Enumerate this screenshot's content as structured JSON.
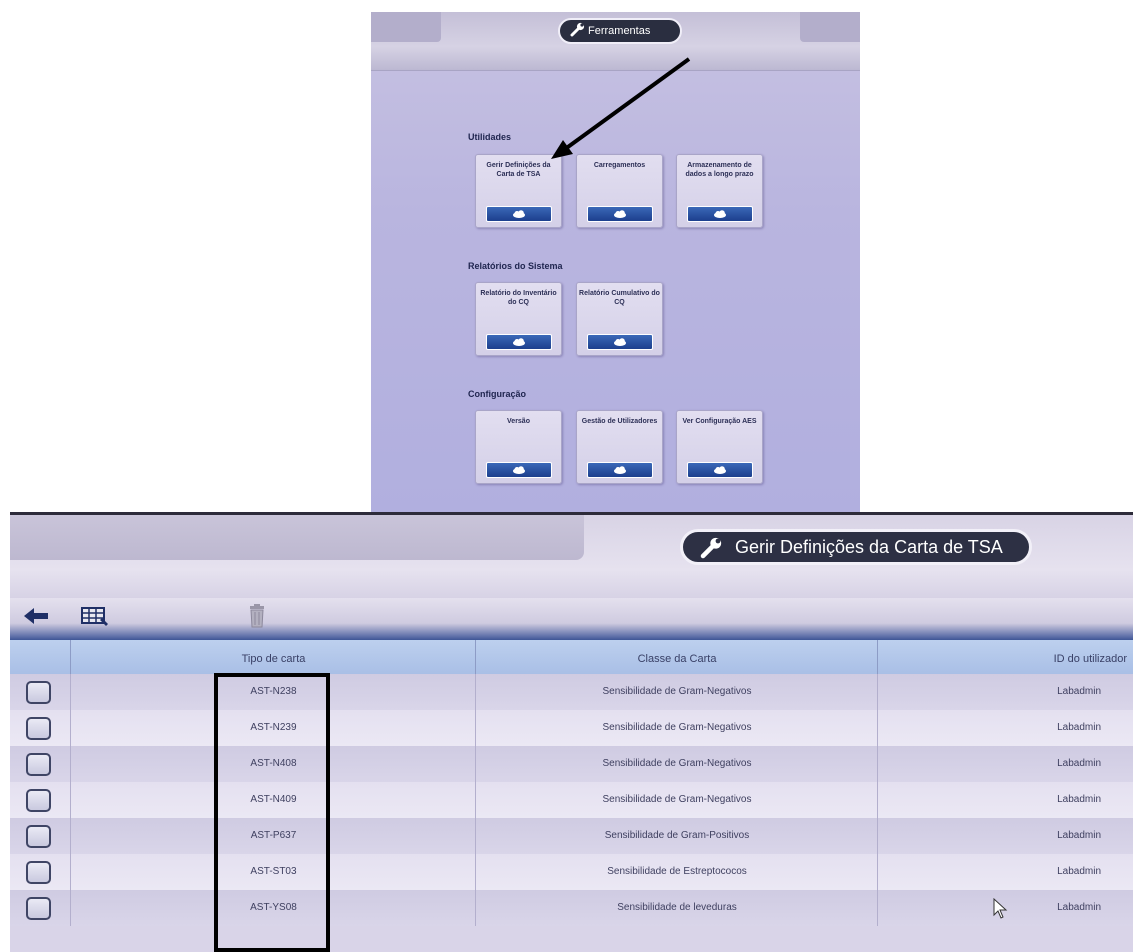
{
  "top_screen": {
    "title": "Ferramentas",
    "sections": [
      {
        "label": "Utilidades",
        "tiles": [
          {
            "label": "Gerir Definições da Carta de TSA"
          },
          {
            "label": "Carregamentos"
          },
          {
            "label": "Armazenamento de dados a longo prazo"
          }
        ]
      },
      {
        "label": "Relatórios do Sistema",
        "tiles": [
          {
            "label": "Relatório do Inventário do CQ"
          },
          {
            "label": "Relatório Cumulativo do CQ"
          }
        ]
      },
      {
        "label": "Configuração",
        "tiles": [
          {
            "label": "Versão"
          },
          {
            "label": "Gestão de Utilizadores"
          },
          {
            "label": "Ver Configuração AES"
          }
        ]
      }
    ]
  },
  "bottom_screen": {
    "title": "Gerir Definições da Carta de TSA",
    "columns": [
      "Tipo de carta",
      "Classe da Carta",
      "ID do utilizador"
    ],
    "rows": [
      {
        "tipo": "AST-N238",
        "classe": "Sensibilidade de Gram-Negativos",
        "user": "Labadmin"
      },
      {
        "tipo": "AST-N239",
        "classe": "Sensibilidade de Gram-Negativos",
        "user": "Labadmin"
      },
      {
        "tipo": "AST-N408",
        "classe": "Sensibilidade de Gram-Negativos",
        "user": "Labadmin"
      },
      {
        "tipo": "AST-N409",
        "classe": "Sensibilidade de Gram-Negativos",
        "user": "Labadmin"
      },
      {
        "tipo": "AST-P637",
        "classe": "Sensibilidade de Gram-Positivos",
        "user": "Labadmin"
      },
      {
        "tipo": "AST-ST03",
        "classe": "Sensibilidade de Estreptococos",
        "user": "Labadmin"
      },
      {
        "tipo": "AST-YS08",
        "classe": "Sensibilidade de leveduras",
        "user": "Labadmin"
      }
    ]
  },
  "icons": {
    "wrench": "wrench-icon",
    "cloud": "cloud-icon",
    "back": "back-arrow-icon",
    "grid": "grid-edit-icon",
    "trash": "trash-icon",
    "cursor": "mouse-cursor-icon"
  },
  "colors": {
    "pill_bg": "#2d3044",
    "tile_button": "#1d3f8d",
    "table_header": "#a9bfe6",
    "highlight": "#000000"
  }
}
